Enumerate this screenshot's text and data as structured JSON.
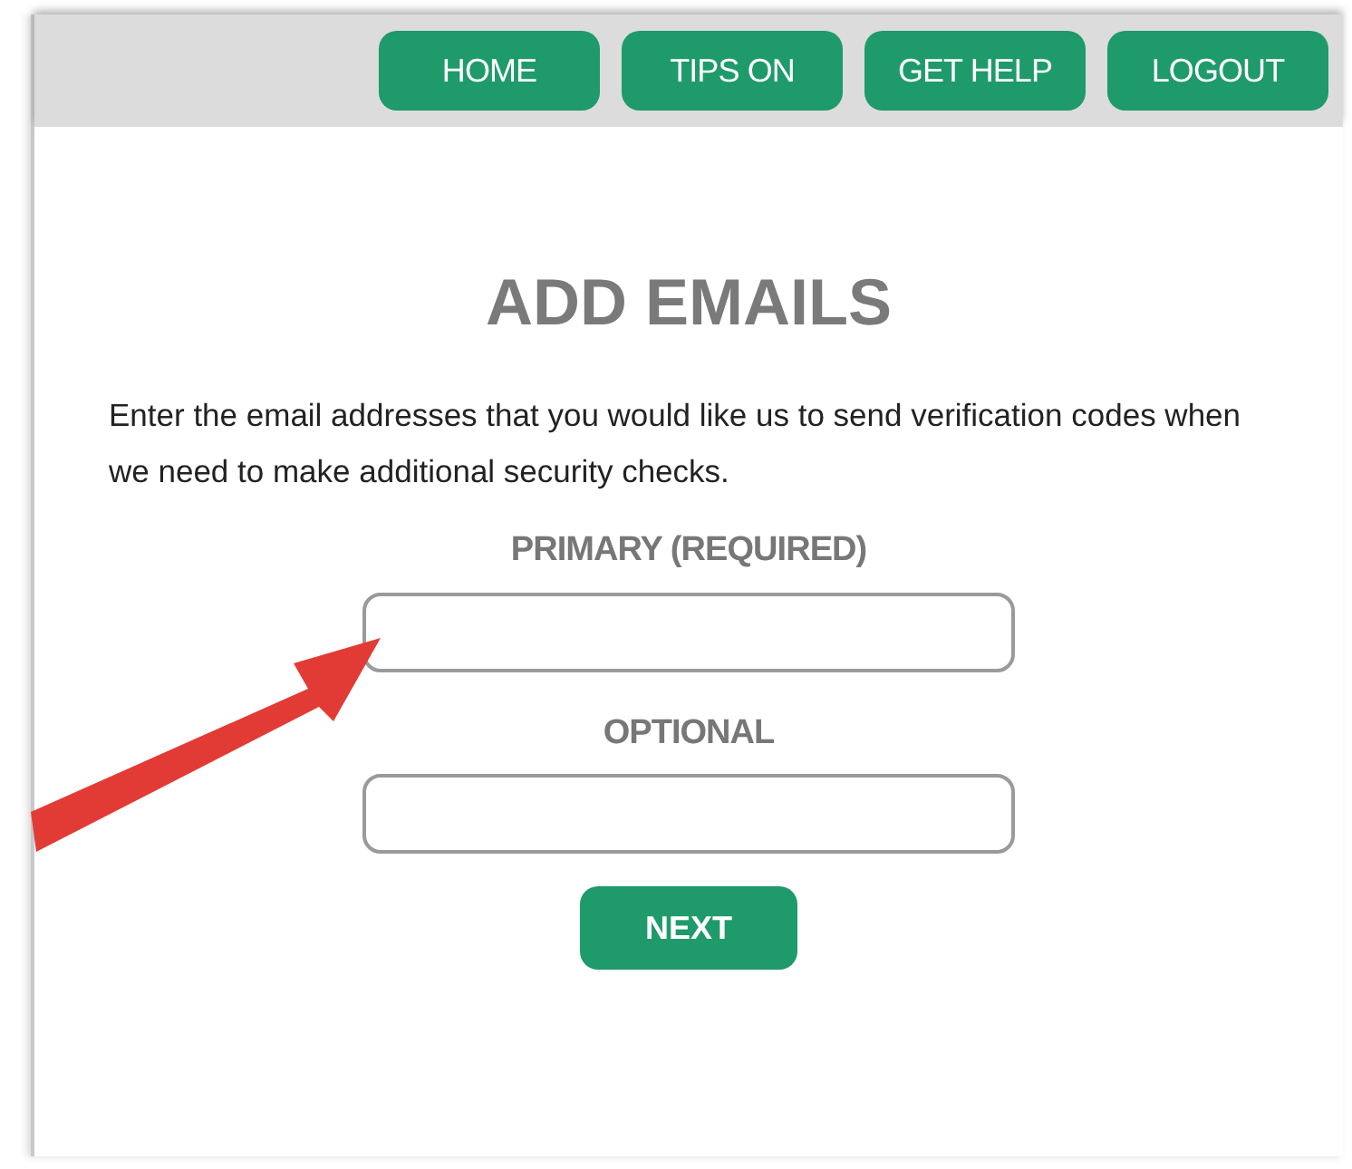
{
  "nav": [
    "HOME",
    "TIPS ON",
    "GET HELP",
    "LOGOUT"
  ],
  "title": "ADD EMAILS",
  "instructions": "Enter the email addresses that you would like us to send verification codes when we need to make additional security checks.",
  "fields": [
    {
      "label": "PRIMARY (REQUIRED)"
    },
    {
      "label": "OPTIONAL"
    }
  ],
  "next_button": "NEXT"
}
